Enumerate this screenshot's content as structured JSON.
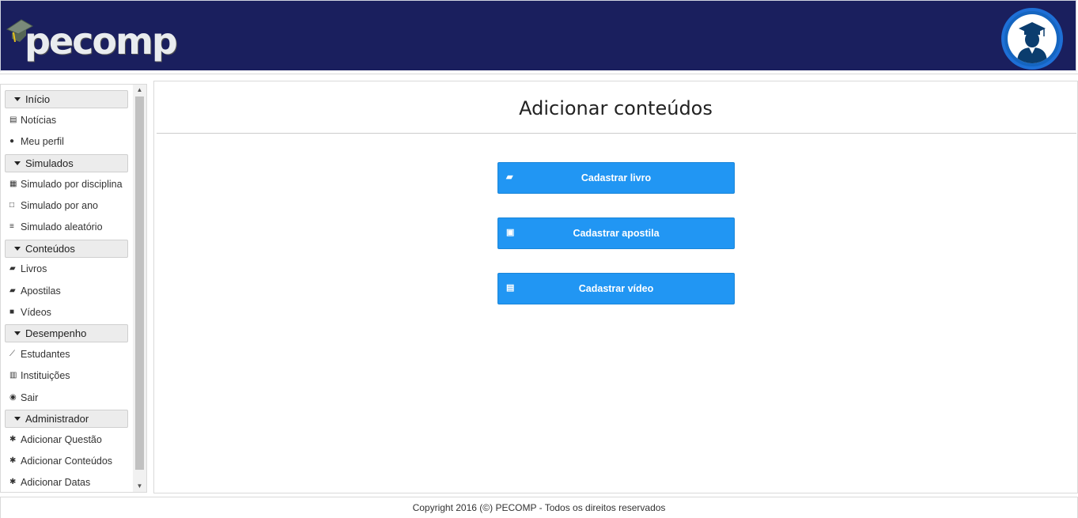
{
  "header": {
    "logo_text": "pecomp",
    "avatar_icon": "graduate-avatar-icon",
    "brand_color": "#1a1f5e"
  },
  "sidebar": {
    "groups": [
      {
        "label": "Início",
        "items": [
          {
            "label": "Notícias",
            "icon": "newspaper-icon"
          },
          {
            "label": "Meu perfil",
            "icon": "user-icon"
          }
        ]
      },
      {
        "label": "Simulados",
        "items": [
          {
            "label": "Simulado por disciplina",
            "icon": "table-icon"
          },
          {
            "label": "Simulado por ano",
            "icon": "calendar-icon"
          },
          {
            "label": "Simulado aleatório",
            "icon": "list-icon"
          }
        ]
      },
      {
        "label": "Conteúdos",
        "items": [
          {
            "label": "Livros",
            "icon": "book-icon"
          },
          {
            "label": "Apostilas",
            "icon": "book-icon"
          },
          {
            "label": "Vídeos",
            "icon": "video-camera-icon"
          }
        ]
      },
      {
        "label": "Desempenho",
        "items": [
          {
            "label": "Estudantes",
            "icon": "line-chart-icon"
          },
          {
            "label": "Instituições",
            "icon": "bar-chart-icon"
          },
          {
            "label": "Sair",
            "icon": "exit-icon"
          }
        ]
      },
      {
        "label": "Administrador",
        "items": [
          {
            "label": "Adicionar Questão",
            "icon": "gear-icon"
          },
          {
            "label": "Adicionar Conteúdos",
            "icon": "gear-icon"
          },
          {
            "label": "Adicionar Datas",
            "icon": "gear-icon"
          }
        ]
      }
    ]
  },
  "main": {
    "title": "Adicionar conteúdos",
    "buttons": [
      {
        "label": "Cadastrar livro",
        "icon": "book-icon"
      },
      {
        "label": "Cadastrar apostila",
        "icon": "document-icon"
      },
      {
        "label": "Cadastrar vídeo",
        "icon": "film-icon"
      }
    ],
    "accent_color": "#2196f3"
  },
  "footer": {
    "text": "Copyright 2016 (©) PECOMP - Todos os direitos reservados"
  }
}
